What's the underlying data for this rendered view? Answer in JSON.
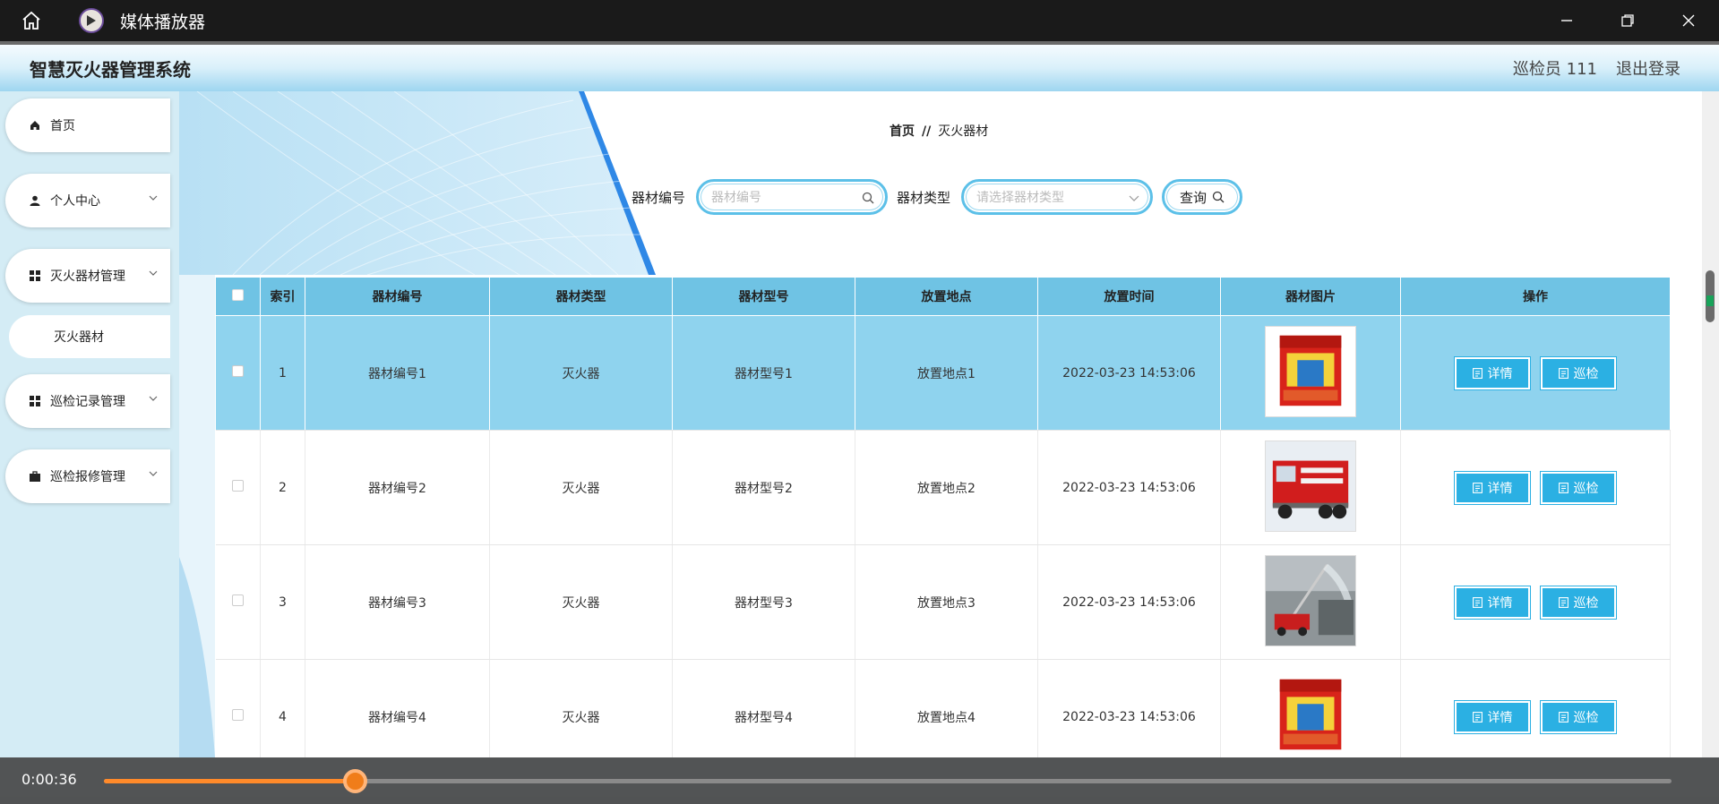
{
  "player": {
    "title": "媒体播放器",
    "time": "0:00:36",
    "progress": 0.16
  },
  "app": {
    "title": "智慧灭火器管理系统",
    "user": "巡检员 111",
    "logout": "退出登录"
  },
  "sidebar": {
    "items": [
      {
        "label": "首页",
        "icon": "home-icon"
      },
      {
        "label": "个人中心",
        "icon": "person-icon"
      },
      {
        "label": "灭火器材管理",
        "icon": "grid-icon"
      },
      {
        "label": "巡检记录管理",
        "icon": "grid-icon"
      },
      {
        "label": "巡检报修管理",
        "icon": "briefcase-icon"
      }
    ],
    "subitem": "灭火器材"
  },
  "breadcrumb": {
    "home": "首页",
    "sep": "//",
    "current": "灭火器材"
  },
  "search": {
    "code_label": "器材编号",
    "code_placeholder": "器材编号",
    "type_label": "器材类型",
    "type_placeholder": "请选择器材类型",
    "query_label": "查询"
  },
  "table": {
    "headers": [
      "索引",
      "器材编号",
      "器材类型",
      "器材型号",
      "放置地点",
      "放置时间",
      "器材图片",
      "操作"
    ],
    "detail_label": "详情",
    "inspect_label": "巡检",
    "rows": [
      {
        "index": "1",
        "code": "器材编号1",
        "type": "灭火器",
        "model": "器材型号1",
        "place": "放置地点1",
        "time": "2022-03-23 14:53:06",
        "image": "extinguisher-box"
      },
      {
        "index": "2",
        "code": "器材编号2",
        "type": "灭火器",
        "model": "器材型号2",
        "place": "放置地点2",
        "time": "2022-03-23 14:53:06",
        "image": "fire-truck"
      },
      {
        "index": "3",
        "code": "器材编号3",
        "type": "灭火器",
        "model": "器材型号3",
        "place": "放置地点3",
        "time": "2022-03-23 14:53:06",
        "image": "spray-truck"
      },
      {
        "index": "4",
        "code": "器材编号4",
        "type": "灭火器",
        "model": "器材型号4",
        "place": "放置地点4",
        "time": "2022-03-23 14:53:06",
        "image": "extinguisher-box"
      }
    ]
  },
  "colors": {
    "accent": "#2bb0e3",
    "header_bg": "#6fc3e4",
    "selected_row": "#8fd3ee",
    "progress": "#ff8a2a"
  }
}
